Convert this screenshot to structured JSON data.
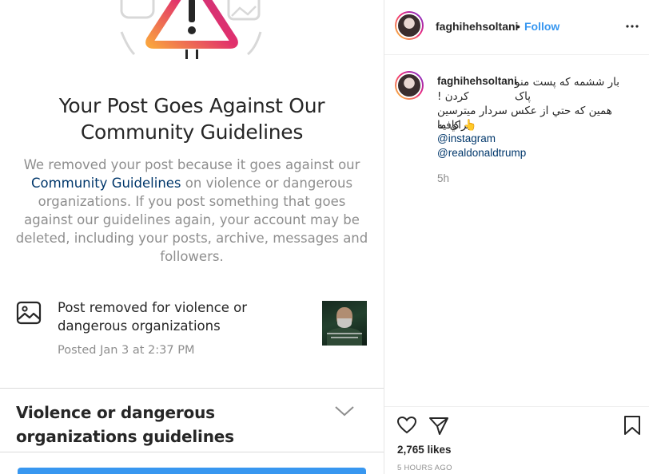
{
  "notice": {
    "title": "Your Post Goes Against Our Community Guidelines",
    "body_prefix": "We removed your post because it goes against our ",
    "body_link": "Community Guidelines",
    "body_suffix": " on violence or dangerous organizations. If you post something that goes against our guidelines again, your account may be deleted, including your posts, archive, messages and followers.",
    "item_text": "Post removed for violence or dangerous organizations",
    "item_date": "Posted Jan 3 at 2:37 PM",
    "guidelines_title": "Violence or dangerous organizations guidelines"
  },
  "header": {
    "username": "faghihehsoltani",
    "separator": "•",
    "follow_label": "Follow"
  },
  "caption": {
    "username": "faghihehsoltani",
    "line1": "بار ششمه که پست منو پاک",
    "line2": "کردن !",
    "line3": "همین که حتي از عکس سردار میترسین براي ما",
    "line4": "👆 کافیه",
    "mention1": "@instagram",
    "mention2": "@realdonaldtrump",
    "time": "5h"
  },
  "footer": {
    "likes": "2,765 likes",
    "time_ago": "5 HOURS AGO"
  },
  "colors": {
    "accent": "#3897f0",
    "link": "#00376b",
    "muted": "#8e8e8e"
  },
  "icons": [
    "warning-icon",
    "image-icon",
    "chevron-down-icon",
    "more-icon",
    "heart-icon",
    "send-icon",
    "bookmark-icon"
  ]
}
